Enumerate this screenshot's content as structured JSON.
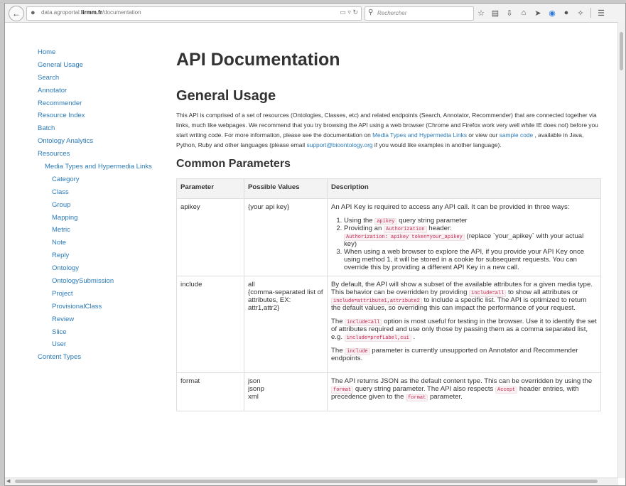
{
  "browser": {
    "url_prefix": "data.agroportal.",
    "url_domain": "lirmm.fr",
    "url_suffix": "/documentation",
    "search_placeholder": "Rechercher",
    "icons": [
      "star-icon",
      "bookmark-list-icon",
      "download-icon",
      "home-icon",
      "send-icon",
      "skype-icon",
      "chat-icon",
      "extension-icon",
      "menu-icon"
    ]
  },
  "sidebar": {
    "items": [
      {
        "label": "Home",
        "level": 0
      },
      {
        "label": "General Usage",
        "level": 0
      },
      {
        "label": "Search",
        "level": 0
      },
      {
        "label": "Annotator",
        "level": 0
      },
      {
        "label": "Recommender",
        "level": 0
      },
      {
        "label": "Resource Index",
        "level": 0
      },
      {
        "label": "Batch",
        "level": 0
      },
      {
        "label": "Ontology Analytics",
        "level": 0
      },
      {
        "label": "Resources",
        "level": 0
      },
      {
        "label": "Media Types and Hypermedia Links",
        "level": 1
      },
      {
        "label": "Category",
        "level": 2
      },
      {
        "label": "Class",
        "level": 2
      },
      {
        "label": "Group",
        "level": 2
      },
      {
        "label": "Mapping",
        "level": 2
      },
      {
        "label": "Metric",
        "level": 2
      },
      {
        "label": "Note",
        "level": 2
      },
      {
        "label": "Reply",
        "level": 2
      },
      {
        "label": "Ontology",
        "level": 2
      },
      {
        "label": "OntologySubmission",
        "level": 2
      },
      {
        "label": "Project",
        "level": 2
      },
      {
        "label": "ProvisionalClass",
        "level": 2
      },
      {
        "label": "Review",
        "level": 2
      },
      {
        "label": "Slice",
        "level": 2
      },
      {
        "label": "User",
        "level": 2
      },
      {
        "label": "Content Types",
        "level": 0
      }
    ]
  },
  "main": {
    "title": "API Documentation",
    "general_heading": "General Usage",
    "intro": {
      "t1": "This API is comprised of a set of resources (Ontologies, Classes, etc) and related endpoints (Search, Annotator, Recommender) that are connected together via links, much like webpages. We recommend that you try browsing the API using a web browser (Chrome and Firefox work very well while IE does not) before you start writing code. For more information, please see the documentation on ",
      "link1": "Media Types and Hypermedia Links",
      "t2": " or view our ",
      "link2": "sample code",
      "t3": " , available in Java, Python, Ruby and other languages (please email ",
      "link3": "support@bioontology.org",
      "t4": " if you would like examples in another language)."
    },
    "common_heading": "Common Parameters",
    "table": {
      "headers": [
        "Parameter",
        "Possible Values",
        "Description"
      ],
      "apikey": {
        "param": "apikey",
        "values": "{your api key}",
        "p1": "An API Key is required to access any API call. It can be provided in three ways:",
        "li1_a": "Using the ",
        "li1_code": "apikey",
        "li1_b": " query string parameter",
        "li2_a": "Providing an ",
        "li2_code": "Authorization",
        "li2_b": " header:",
        "li2_code2": "Authorization: apikey token=your_apikey",
        "li2_c": " (replace `your_apikey` with your actual key)",
        "li3": "When using a web browser to explore the API, if you provide your API Key once using method 1, it will be stored in a cookie for subsequent requests. You can override this by providing a different API Key in a new call."
      },
      "include": {
        "param": "include",
        "values_1": "all",
        "values_2": "{comma-separated list of attributes, EX: attr1,attr2}",
        "p1_a": "By default, the API will show a subset of the available attributes for a given media type. This behavior can be overridden by providing ",
        "p1_code1": "include=all",
        "p1_b": " to show all attributes or ",
        "p1_code2": "include=attribute1,attribute2",
        "p1_c": " to include a specific list. The API is optimized to return the default values, so overriding this can impact the performance of your request.",
        "p2_a": "The ",
        "p2_code1": "include=all",
        "p2_b": " option is most useful for testing in the browser. Use it to identify the set of attributes required and use only those by passing them as a comma separated list, e.g. ",
        "p2_code2": "include=prefLabel,cui",
        "p2_c": " .",
        "p3_a": "The ",
        "p3_code": "include",
        "p3_b": " parameter is currently unsupported on Annotator and Recommender endpoints."
      },
      "format": {
        "param": "format",
        "v1": "json",
        "v2": "jsonp",
        "v3": "xml",
        "p1_a": "The API returns JSON as the default content type. This can be overridden by using the ",
        "p1_code": "format",
        "p1_b": " query string parameter. The API also respects ",
        "p1_code2": "Accept",
        "p1_c": " header entries, with precedence given to the ",
        "p1_code3": "format",
        "p1_d": " parameter."
      }
    }
  }
}
